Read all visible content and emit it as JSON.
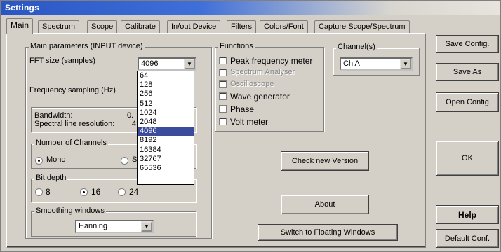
{
  "window": {
    "title": "Settings"
  },
  "tabs": [
    "Main",
    "Spectrum",
    "Scope",
    "Calibrate",
    "In/out Device",
    "Filters",
    "Colors/Font",
    "Capture Scope/Spectrum"
  ],
  "main_params": {
    "group_title": "Main parameters (INPUT device)",
    "fft_label": "FFT size (samples)",
    "fft_value": "4096",
    "fft_options": [
      "64",
      "128",
      "256",
      "512",
      "1024",
      "2048",
      "4096",
      "8192",
      "16384",
      "32767",
      "65536"
    ],
    "fft_selected": "4096",
    "freq_label": "Frequency sampling (Hz)",
    "bandwidth_label": "Bandwidth:",
    "bandwidth_value": "0.",
    "spectral_label": "Spectral line resolution:",
    "spectral_value": "4"
  },
  "channels_group": {
    "title": "Number of Channels",
    "mono": "Mono",
    "stereo": "S",
    "selected": "Mono"
  },
  "bit_depth_group": {
    "title": "Bit depth",
    "options": [
      "8",
      "16",
      "24"
    ],
    "selected": "16"
  },
  "smoothing_group": {
    "title": "Smoothing windows",
    "value": "Hanning"
  },
  "functions": {
    "title": "Functions",
    "items": [
      {
        "label": "Peak frequency meter",
        "enabled": true,
        "checked": false
      },
      {
        "label": "Spectrum Analyser",
        "enabled": false,
        "checked": false
      },
      {
        "label": "Oscilloscope",
        "enabled": false,
        "checked": false
      },
      {
        "label": "Wave generator",
        "enabled": true,
        "checked": false
      },
      {
        "label": "Phase",
        "enabled": true,
        "checked": false
      },
      {
        "label": "Volt meter",
        "enabled": true,
        "checked": false
      }
    ]
  },
  "channel_select": {
    "title": "Channel(s)",
    "value": "Ch A"
  },
  "buttons": {
    "check_version": "Check new Version",
    "about": "About",
    "floating": "Switch to Floating Windows",
    "save_config": "Save Config.",
    "save_as": "Save As",
    "open_config": "Open Config",
    "ok": "OK",
    "help": "Help",
    "default_conf": "Default Conf."
  }
}
